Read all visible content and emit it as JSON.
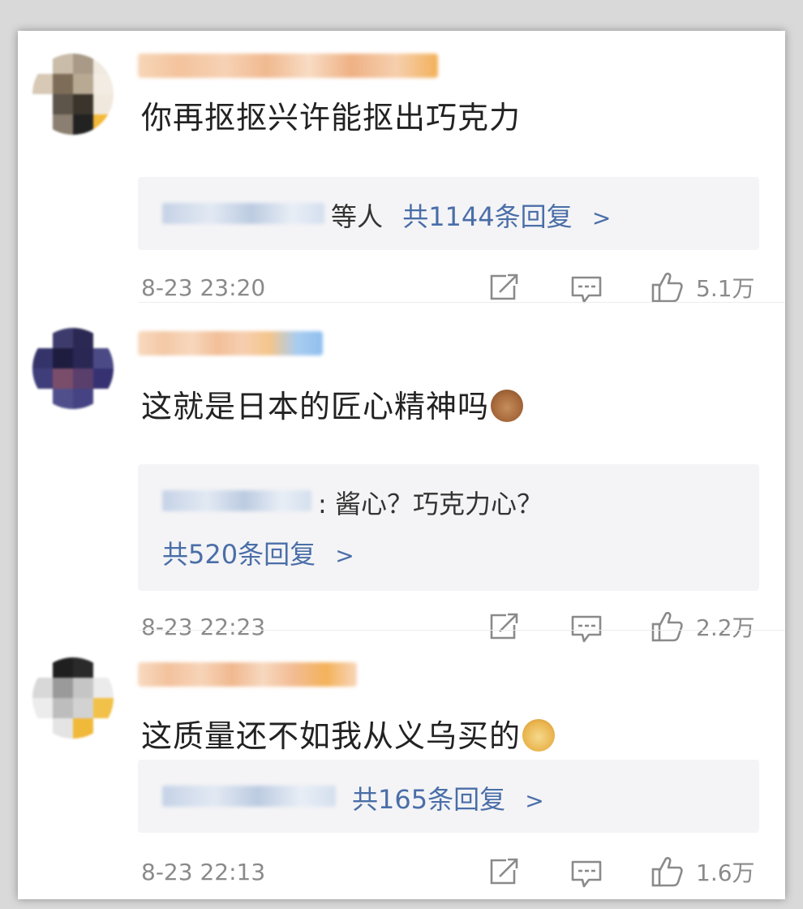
{
  "comments": [
    {
      "text": "你再抠抠兴许能抠出巧克力",
      "reply_suffix": "等人",
      "reply_count_label": "共1144条回复",
      "reply_chevron": ">",
      "time": "8-23 23:20",
      "likes": "5.1万",
      "avatar_colors": [
        "#ffffff",
        "#c9bca8",
        "#a89a86",
        "#efe9df",
        "#d7c9b5",
        "#7d6c58",
        "#b8a993",
        "#f2ece3",
        "#ffffff",
        "#5d544a",
        "#3a342c",
        "#f0e8dc",
        "#ffffff",
        "#8a7f70",
        "#222222",
        "#f3b93a"
      ],
      "name_colors": [
        "#f7d6b8",
        "#f3c39c",
        "#f7d2b5",
        "#f0b98f",
        "#f8dcc4",
        "#efb184",
        "#f6cfae",
        "#f3b15a"
      ]
    },
    {
      "text": "这就是日本的匠心精神吗",
      "emoji": "jerry-mouse-emoji",
      "reply_preview_text": ": 酱心？巧克力心？",
      "reply_count_label": "共520条回复",
      "reply_chevron": ">",
      "time": "8-23 22:23",
      "likes": "2.2万",
      "avatar_colors": [
        "#ffffff",
        "#3d3b6b",
        "#2b2953",
        "#ffffff",
        "#35346a",
        "#1e1c3f",
        "#2a2755",
        "#4b4a86",
        "#3f3d7a",
        "#7a4e6a",
        "#5a3f6c",
        "#363272",
        "#ffffff",
        "#504f8c",
        "#454383",
        "#ffffff"
      ],
      "name_colors": [
        "#f8d9bf",
        "#f4c9a6",
        "#f7d7bd",
        "#f2bf98",
        "#f6cfb1",
        "#f5c58b",
        "#a9cdf0",
        "#8fbfef"
      ]
    },
    {
      "text": "这质量还不如我从义乌买的",
      "emoji": "doge-emoji",
      "reply_count_label": "共165条回复",
      "reply_chevron": ">",
      "time": "8-23 22:13",
      "likes": "1.6万",
      "avatar_colors": [
        "#ffffff",
        "#1f1f1f",
        "#2a2a2a",
        "#ffffff",
        "#d8d8d8",
        "#9a9a9a",
        "#c5c5c5",
        "#ebebeb",
        "#ececec",
        "#bdbdbd",
        "#d2d2d2",
        "#f2c14a",
        "#ffffff",
        "#e4e4e4",
        "#f0b93a",
        "#ffffff"
      ],
      "name_colors": [
        "#f8dac1",
        "#f3c29d",
        "#f7d4b8",
        "#f0b88f",
        "#f7d8bf",
        "#f2bc93",
        "#f4b25a",
        "#f8d6bb"
      ]
    }
  ],
  "icons": {
    "share": "share-icon",
    "comment": "comment-icon",
    "like": "thumbs-up-icon"
  }
}
